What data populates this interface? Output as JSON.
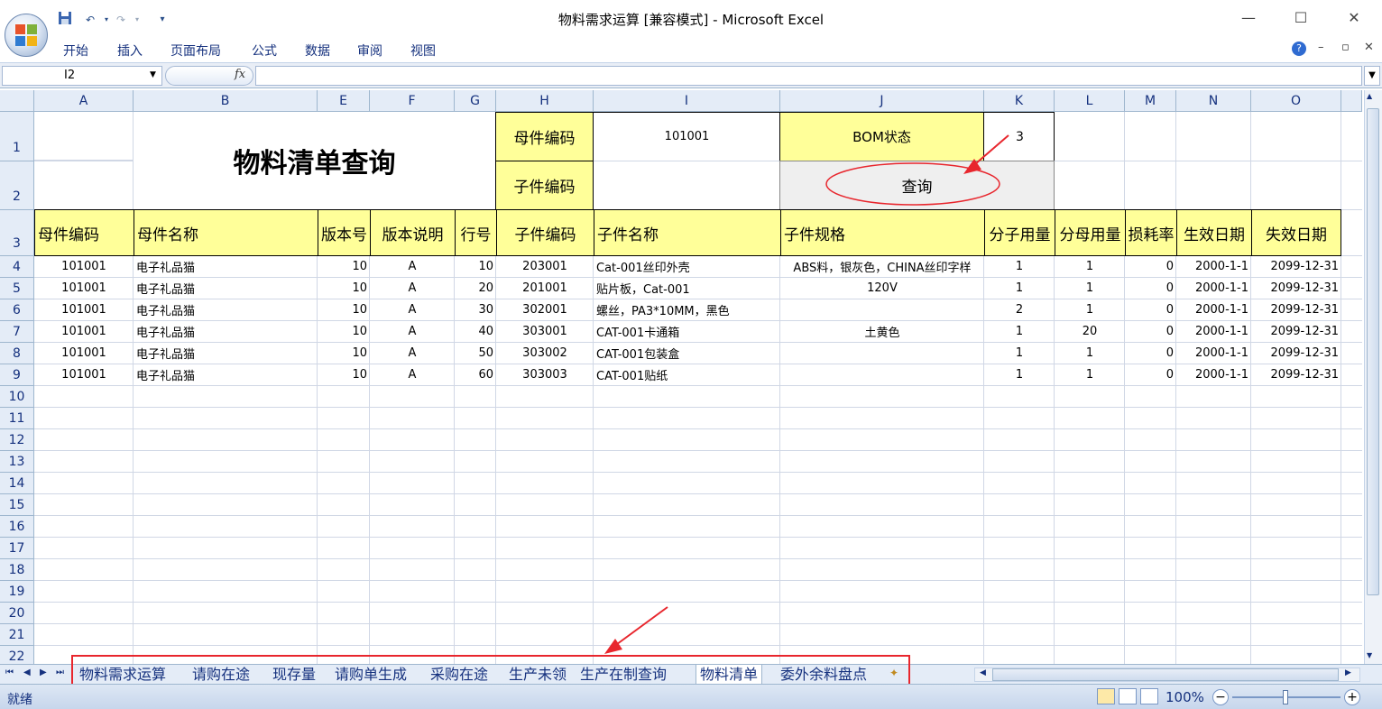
{
  "window": {
    "title": "物料需求运算  [兼容模式] - Microsoft Excel",
    "qat": {
      "save_icon": "save-icon",
      "undo_icon": "undo-icon",
      "redo_icon": "redo-icon",
      "customize_icon": "qat-dropdown-icon"
    },
    "controls": {
      "minimize": "—",
      "maximize": "☐",
      "close": "✕"
    }
  },
  "ribbon": {
    "tabs": [
      "开始",
      "插入",
      "页面布局",
      "公式",
      "数据",
      "审阅",
      "视图"
    ],
    "help": "?",
    "mini_min": "–",
    "mini_restore": "▫",
    "mini_close": "✕"
  },
  "formula_bar": {
    "name_box": "I2",
    "fx": "fx",
    "formula": ""
  },
  "columns": [
    "A",
    "B",
    "E",
    "F",
    "G",
    "H",
    "I",
    "J",
    "K",
    "L",
    "M",
    "N",
    "O"
  ],
  "rows": [
    "1",
    "2",
    "3",
    "4",
    "5",
    "6",
    "7",
    "8",
    "9",
    "10",
    "11",
    "12",
    "13",
    "14",
    "15",
    "16",
    "17",
    "18",
    "19",
    "20",
    "21",
    "22"
  ],
  "header_block": {
    "title": "物料清单查询",
    "parent_code_label": "母件编码",
    "parent_code_value": "101001",
    "child_code_label": "子件编码",
    "child_code_value": "",
    "bom_status_label": "BOM状态",
    "bom_status_value": "3",
    "query_button": "查询"
  },
  "table": {
    "headers": [
      "母件编码",
      "母件名称",
      "版本号",
      "版本说明",
      "行号",
      "子件编码",
      "子件名称",
      "子件规格",
      "分子用量",
      "分母用量",
      "损耗率",
      "生效日期",
      "失效日期"
    ],
    "rows": [
      [
        "101001",
        "电子礼品猫",
        "10",
        "A",
        "10",
        "203001",
        "Cat-001丝印外壳",
        "ABS料，银灰色，CHINA丝印字样",
        "1",
        "1",
        "0",
        "2000-1-1",
        "2099-12-31"
      ],
      [
        "101001",
        "电子礼品猫",
        "10",
        "A",
        "20",
        "201001",
        "贴片板，Cat-001",
        "120V",
        "1",
        "1",
        "0",
        "2000-1-1",
        "2099-12-31"
      ],
      [
        "101001",
        "电子礼品猫",
        "10",
        "A",
        "30",
        "302001",
        "螺丝，PA3*10MM，黑色",
        "",
        "2",
        "1",
        "0",
        "2000-1-1",
        "2099-12-31"
      ],
      [
        "101001",
        "电子礼品猫",
        "10",
        "A",
        "40",
        "303001",
        "CAT-001卡通箱",
        "土黄色",
        "1",
        "20",
        "0",
        "2000-1-1",
        "2099-12-31"
      ],
      [
        "101001",
        "电子礼品猫",
        "10",
        "A",
        "50",
        "303002",
        "CAT-001包装盒",
        "",
        "1",
        "1",
        "0",
        "2000-1-1",
        "2099-12-31"
      ],
      [
        "101001",
        "电子礼品猫",
        "10",
        "A",
        "60",
        "303003",
        "CAT-001贴纸",
        "",
        "1",
        "1",
        "0",
        "2000-1-1",
        "2099-12-31"
      ]
    ]
  },
  "sheet_tabs": [
    "物料需求运算",
    "请购在途",
    "现存量",
    "请购单生成",
    "采购在途",
    "生产未领",
    "生产在制查询",
    "物料清单",
    "委外余料盘点"
  ],
  "active_sheet": "物料清单",
  "nav_buttons": [
    "⏮",
    "◀",
    "▶",
    "⏭"
  ],
  "status": {
    "text": "就绪",
    "zoom": "100%",
    "zoom_minus": "−",
    "zoom_plus": "+"
  },
  "colors": {
    "highlight_yellow": "#ffff99",
    "annotation_red": "#e8262d",
    "header_blue": "#e4ecf7"
  }
}
